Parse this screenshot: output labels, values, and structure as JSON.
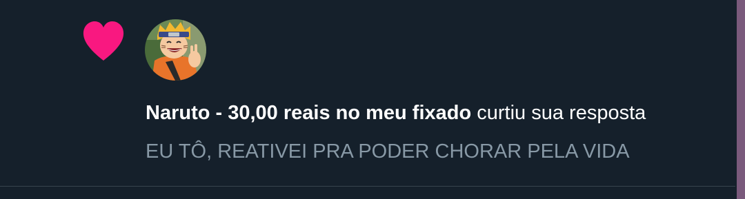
{
  "notification": {
    "icon": "heart-icon",
    "accent_color": "#f91880",
    "avatar": "naruto-avatar",
    "user_name": "Naruto - 30,00 reais no meu fixado",
    "action_text": "curtiu sua resposta",
    "reply_preview": "EU TÔ, REATIVEI PRA PODER CHORAR PELA VIDA"
  },
  "colors": {
    "background": "#15202b",
    "secondary_text": "#8899a6",
    "divider": "#38444d"
  }
}
